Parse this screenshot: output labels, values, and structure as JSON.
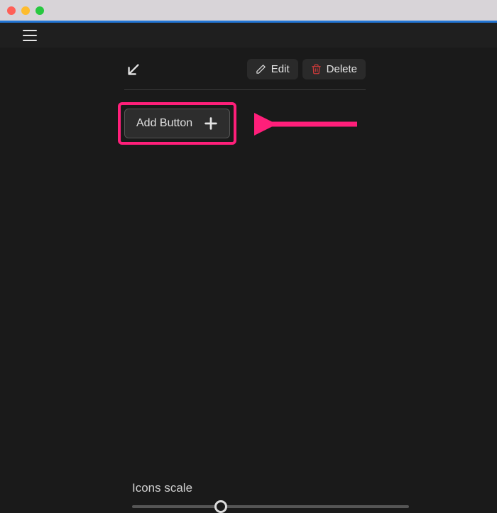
{
  "toolbar": {
    "edit_label": "Edit",
    "delete_label": "Delete"
  },
  "add_button": {
    "label": "Add Button"
  },
  "footer": {
    "icons_scale_label": "Icons scale"
  },
  "colors": {
    "highlight": "#ff1f7a"
  }
}
